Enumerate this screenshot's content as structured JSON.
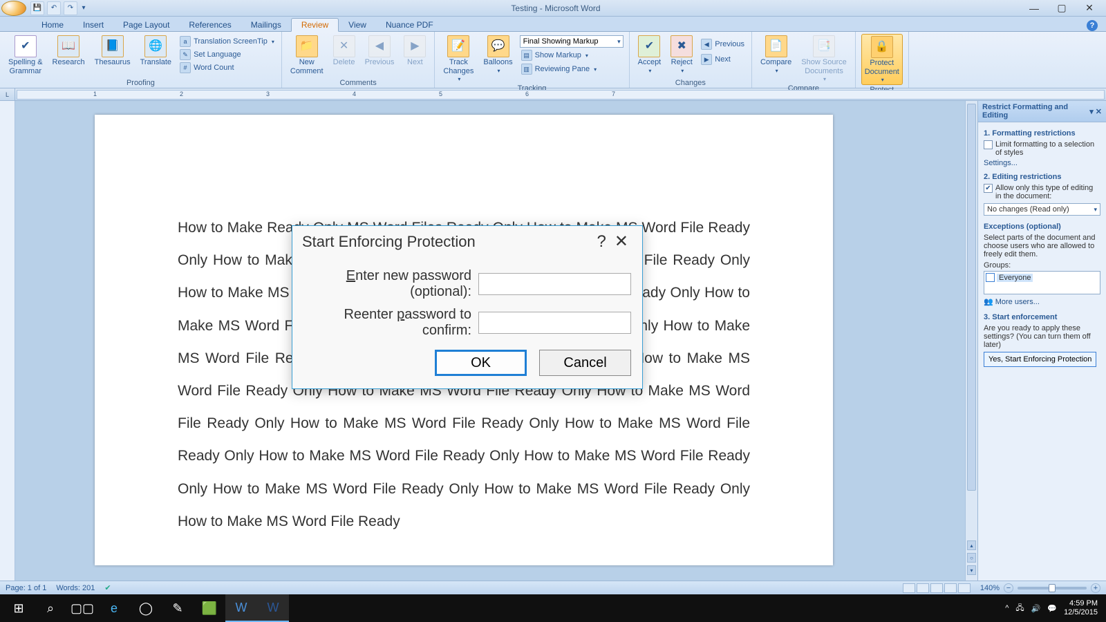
{
  "window": {
    "title": "Testing - Microsoft Word"
  },
  "qat": [
    "save",
    "undo",
    "redo"
  ],
  "tabs": [
    "Home",
    "Insert",
    "Page Layout",
    "References",
    "Mailings",
    "Review",
    "View",
    "Nuance PDF"
  ],
  "active_tab": "Review",
  "ribbon": {
    "proofing": {
      "label": "Proofing",
      "spelling": "Spelling &\nGrammar",
      "research": "Research",
      "thesaurus": "Thesaurus",
      "translate": "Translate",
      "screentip": "Translation ScreenTip",
      "setlang": "Set Language",
      "wordcount": "Word Count"
    },
    "comments": {
      "label": "Comments",
      "new": "New\nComment",
      "delete": "Delete",
      "previous": "Previous",
      "next": "Next"
    },
    "tracking": {
      "label": "Tracking",
      "track": "Track\nChanges",
      "balloons": "Balloons",
      "display": "Final Showing Markup",
      "showmarkup": "Show Markup",
      "reviewing": "Reviewing Pane"
    },
    "changes": {
      "label": "Changes",
      "accept": "Accept",
      "reject": "Reject",
      "previous": "Previous",
      "next": "Next"
    },
    "compare": {
      "label": "Compare",
      "compare": "Compare",
      "showsource": "Show Source\nDocuments"
    },
    "protect": {
      "label": "Protect",
      "protect": "Protect\nDocument"
    }
  },
  "document": {
    "text": "How to Make Ready Only MS Word Files Ready Only How to Make MS Word File Ready Only How to Make MS Word File Ready Only How to Make MS Word File Ready Only How to Make MS Word File Ready Only How to Make MS Word File Ready Only How to Make MS Word File Ready Only How to Make MS Word File Ready Only How to Make MS Word File Ready Only How to Make MS Word File Ready Only How to Make MS Word File Ready Only How to Make MS Word File Ready Only How to Make MS Word File Ready Only How to Make MS Word File Ready Only How to Make MS Word File Ready Only How to Make MS Word File Ready Only How to Make MS Word File Ready Only How to Make MS Word File Ready Only How to Make MS Word File Ready Only How to Make MS Word File Ready"
  },
  "sidepane": {
    "title": "Restrict Formatting and Editing",
    "s1": "1. Formatting restrictions",
    "s1chk": "Limit formatting to a selection of styles",
    "settings": "Settings...",
    "s2": "2. Editing restrictions",
    "s2chk": "Allow only this type of editing in the document:",
    "s2sel": "No changes (Read only)",
    "exc": "Exceptions (optional)",
    "excdesc": "Select parts of the document and choose users who are allowed to freely edit them.",
    "groups": "Groups:",
    "everyone": "Everyone",
    "moreusers": "More users...",
    "s3": "3. Start enforcement",
    "s3desc": "Are you ready to apply these settings? (You can turn them off later)",
    "enforce": "Yes, Start Enforcing Protection"
  },
  "dialog": {
    "title": "Start Enforcing Protection",
    "label1": "Enter new password (optional):",
    "label2": "Reenter password to confirm:",
    "ok": "OK",
    "cancel": "Cancel"
  },
  "statusbar": {
    "page": "Page: 1 of 1",
    "words": "Words: 201",
    "zoom": "140%"
  },
  "ruler_numbers": [
    "1",
    "2",
    "3",
    "4",
    "5",
    "6",
    "7"
  ],
  "taskbar": {
    "time": "4:59 PM",
    "date": "12/5/2015"
  }
}
